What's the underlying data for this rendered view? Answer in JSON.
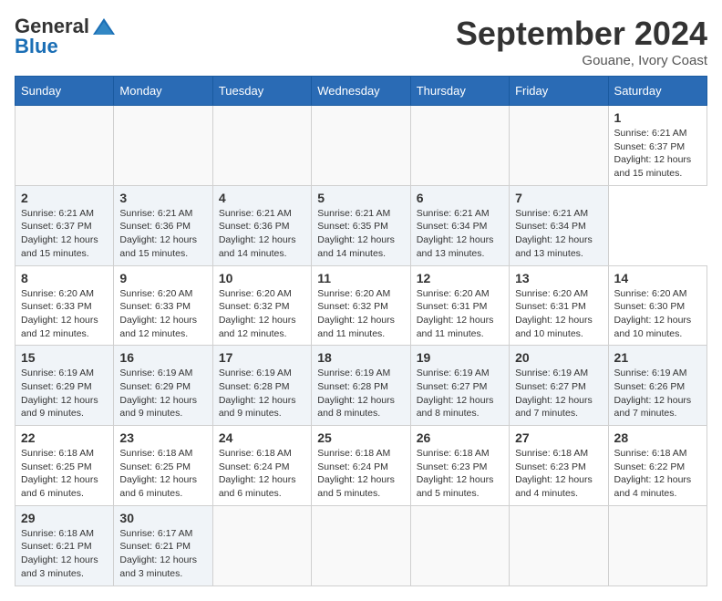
{
  "header": {
    "logo": {
      "general": "General",
      "blue": "Blue",
      "tagline": ""
    },
    "title": "September 2024",
    "location": "Gouane, Ivory Coast"
  },
  "calendar": {
    "days_of_week": [
      "Sunday",
      "Monday",
      "Tuesday",
      "Wednesday",
      "Thursday",
      "Friday",
      "Saturday"
    ],
    "weeks": [
      [
        null,
        null,
        null,
        null,
        null,
        null,
        {
          "day": 1,
          "sunrise": "6:21 AM",
          "sunset": "6:37 PM",
          "daylight": "12 hours and 15 minutes."
        }
      ],
      [
        {
          "day": 2,
          "sunrise": "6:21 AM",
          "sunset": "6:37 PM",
          "daylight": "12 hours and 15 minutes."
        },
        {
          "day": 3,
          "sunrise": "6:21 AM",
          "sunset": "6:36 PM",
          "daylight": "12 hours and 15 minutes."
        },
        {
          "day": 4,
          "sunrise": "6:21 AM",
          "sunset": "6:36 PM",
          "daylight": "12 hours and 14 minutes."
        },
        {
          "day": 5,
          "sunrise": "6:21 AM",
          "sunset": "6:35 PM",
          "daylight": "12 hours and 14 minutes."
        },
        {
          "day": 6,
          "sunrise": "6:21 AM",
          "sunset": "6:34 PM",
          "daylight": "12 hours and 13 minutes."
        },
        {
          "day": 7,
          "sunrise": "6:21 AM",
          "sunset": "6:34 PM",
          "daylight": "12 hours and 13 minutes."
        }
      ],
      [
        {
          "day": 8,
          "sunrise": "6:20 AM",
          "sunset": "6:33 PM",
          "daylight": "12 hours and 12 minutes."
        },
        {
          "day": 9,
          "sunrise": "6:20 AM",
          "sunset": "6:33 PM",
          "daylight": "12 hours and 12 minutes."
        },
        {
          "day": 10,
          "sunrise": "6:20 AM",
          "sunset": "6:32 PM",
          "daylight": "12 hours and 12 minutes."
        },
        {
          "day": 11,
          "sunrise": "6:20 AM",
          "sunset": "6:32 PM",
          "daylight": "12 hours and 11 minutes."
        },
        {
          "day": 12,
          "sunrise": "6:20 AM",
          "sunset": "6:31 PM",
          "daylight": "12 hours and 11 minutes."
        },
        {
          "day": 13,
          "sunrise": "6:20 AM",
          "sunset": "6:31 PM",
          "daylight": "12 hours and 10 minutes."
        },
        {
          "day": 14,
          "sunrise": "6:20 AM",
          "sunset": "6:30 PM",
          "daylight": "12 hours and 10 minutes."
        }
      ],
      [
        {
          "day": 15,
          "sunrise": "6:19 AM",
          "sunset": "6:29 PM",
          "daylight": "12 hours and 9 minutes."
        },
        {
          "day": 16,
          "sunrise": "6:19 AM",
          "sunset": "6:29 PM",
          "daylight": "12 hours and 9 minutes."
        },
        {
          "day": 17,
          "sunrise": "6:19 AM",
          "sunset": "6:28 PM",
          "daylight": "12 hours and 9 minutes."
        },
        {
          "day": 18,
          "sunrise": "6:19 AM",
          "sunset": "6:28 PM",
          "daylight": "12 hours and 8 minutes."
        },
        {
          "day": 19,
          "sunrise": "6:19 AM",
          "sunset": "6:27 PM",
          "daylight": "12 hours and 8 minutes."
        },
        {
          "day": 20,
          "sunrise": "6:19 AM",
          "sunset": "6:27 PM",
          "daylight": "12 hours and 7 minutes."
        },
        {
          "day": 21,
          "sunrise": "6:19 AM",
          "sunset": "6:26 PM",
          "daylight": "12 hours and 7 minutes."
        }
      ],
      [
        {
          "day": 22,
          "sunrise": "6:18 AM",
          "sunset": "6:25 PM",
          "daylight": "12 hours and 6 minutes."
        },
        {
          "day": 23,
          "sunrise": "6:18 AM",
          "sunset": "6:25 PM",
          "daylight": "12 hours and 6 minutes."
        },
        {
          "day": 24,
          "sunrise": "6:18 AM",
          "sunset": "6:24 PM",
          "daylight": "12 hours and 6 minutes."
        },
        {
          "day": 25,
          "sunrise": "6:18 AM",
          "sunset": "6:24 PM",
          "daylight": "12 hours and 5 minutes."
        },
        {
          "day": 26,
          "sunrise": "6:18 AM",
          "sunset": "6:23 PM",
          "daylight": "12 hours and 5 minutes."
        },
        {
          "day": 27,
          "sunrise": "6:18 AM",
          "sunset": "6:23 PM",
          "daylight": "12 hours and 4 minutes."
        },
        {
          "day": 28,
          "sunrise": "6:18 AM",
          "sunset": "6:22 PM",
          "daylight": "12 hours and 4 minutes."
        }
      ],
      [
        {
          "day": 29,
          "sunrise": "6:18 AM",
          "sunset": "6:21 PM",
          "daylight": "12 hours and 3 minutes."
        },
        {
          "day": 30,
          "sunrise": "6:17 AM",
          "sunset": "6:21 PM",
          "daylight": "12 hours and 3 minutes."
        },
        null,
        null,
        null,
        null,
        null
      ]
    ]
  }
}
